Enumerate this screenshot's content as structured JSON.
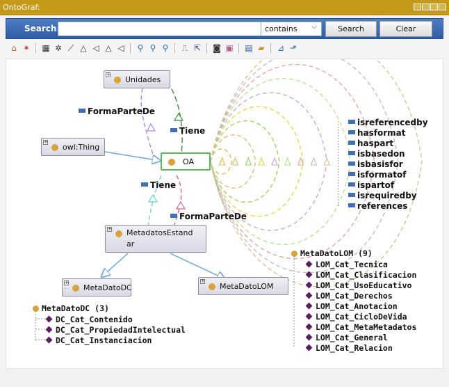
{
  "window": {
    "title": "OntoGraf:"
  },
  "search": {
    "label": "Search:",
    "value": "",
    "placeholder": "",
    "mode": "contains",
    "search_button": "Search",
    "clear_button": "Clear"
  },
  "toolbar": {
    "icons": [
      "home-icon",
      "layout-radial-icon",
      "grid-layout-icon",
      "spring-layout-icon",
      "tree-layout-icon",
      "tree-horizontal-icon",
      "tree-vertical-icon",
      "tree-horizontal-alt-icon",
      "zoom-in-icon",
      "zoom-fit-icon",
      "zoom-out-icon",
      "filter-icon",
      "export-icon",
      "snapshot-icon",
      "image-icon",
      "save-icon",
      "open-icon",
      "chart-icon",
      "share-icon"
    ]
  },
  "graph": {
    "nodes": {
      "unidades": "Unidades",
      "owl_thing": "owl:Thing",
      "oa": "OA",
      "metadatos_estandar_line1": "MetadatosEstand",
      "metadatos_estandar_line2": "ar",
      "metadato_dc": "MetaDatoDC",
      "metadato_lom": "MetaDatoLOM"
    },
    "edge_labels": {
      "forma_parte_de_top": "FormaParteDe",
      "tiene_top": "Tiene",
      "tiene_bottom": "Tiene",
      "forma_parte_de_bottom": "FormaParteDe"
    },
    "legend": [
      "isreferencedby",
      "hasformat",
      "haspart",
      "isbasedon",
      "isbasisfor",
      "isformatof",
      "ispartof",
      "isrequiredby",
      "references"
    ],
    "legend_colors": [
      "#e0b84a",
      "#c7c070",
      "#9bcf5a",
      "#d9d94a",
      "#c3a2e0",
      "#b9e08f",
      "#e6a0a0",
      "#bcbcbc",
      "#d4c08e"
    ]
  },
  "tree_dc": {
    "root": "MetaDatoDC (3)",
    "items": [
      "DC_Cat_Contenido",
      "DC_Cat_PropiedadIntelectual",
      "DC_Cat_Instanciacion"
    ]
  },
  "tree_lom": {
    "root": "MetaDatoLOM (9)",
    "items": [
      "LOM_Cat_Tecnica",
      "LOM_Cat_Clasificacion",
      "LOM_Cat_UsoEducativo",
      "LOM_Cat_Derechos",
      "LOM_Cat_Anotacion",
      "LOM_Cat_CicloDeVida",
      "LOM_Cat_MetaMetadatos",
      "LOM_Cat_General",
      "LOM_Cat_Relacion"
    ]
  }
}
